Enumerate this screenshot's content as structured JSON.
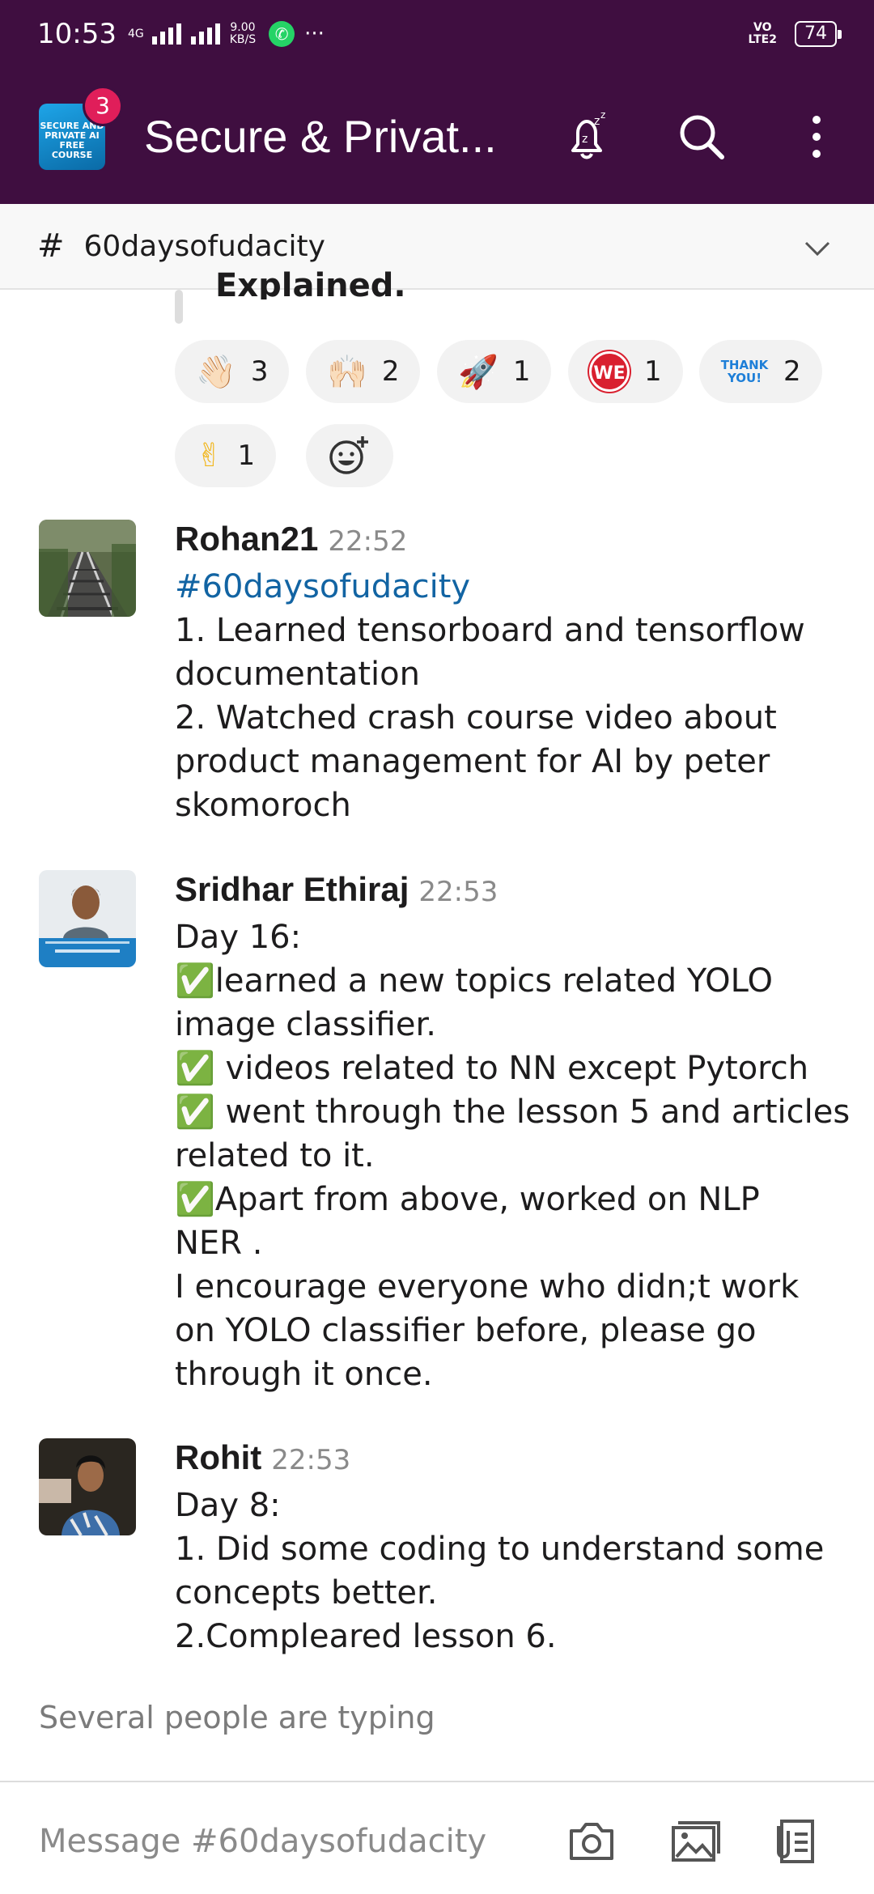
{
  "status_bar": {
    "time": "10:53",
    "net_top": "4G",
    "speed_value": "9.00",
    "speed_unit": "KB/S",
    "more": "···",
    "volte_top": "VO",
    "volte_bottom": "LTE2",
    "battery": "74"
  },
  "app_bar": {
    "workspace_icon_text": "SECURE AND PRIVATE AI FREE COURSE",
    "badge_count": "3",
    "title": "Secure & Privat..."
  },
  "channel_bar": {
    "hash": "#",
    "channel_name": "60daysofudacity"
  },
  "prev_message": {
    "quote_fragment": "Explained."
  },
  "reactions": [
    {
      "emoji": "👋🏻",
      "count": "3"
    },
    {
      "emoji": "🙌🏻",
      "count": "2"
    },
    {
      "emoji": "🚀",
      "count": "1"
    },
    {
      "emoji": "WE",
      "count": "1"
    },
    {
      "emoji": "THANK YOU!",
      "count": "2"
    },
    {
      "emoji": "✌",
      "count": "1"
    }
  ],
  "messages": [
    {
      "author": "Rohan21",
      "time": "22:52",
      "lines": [
        "#60daysofudacity",
        "1. Learned tensorboard and tensorflow",
        "documentation",
        "2. Watched crash course video about",
        "product management for AI by peter",
        "skomoroch"
      ]
    },
    {
      "author": "Sridhar Ethiraj",
      "time": "22:53",
      "lines": [
        "Day 16:",
        "✅learned a new topics related YOLO",
        "image classifier.",
        "✅ videos related to NN except Pytorch",
        "✅ went through the lesson 5 and articles",
        "related to it.",
        "✅Apart from above, worked on NLP",
        "NER .",
        "I encourage everyone who didn;t work",
        "on YOLO classifier before, please go",
        "through it once."
      ]
    },
    {
      "author": "Rohit",
      "time": "22:53",
      "lines": [
        "Day 8:",
        "1. Did some coding to understand some",
        "concepts better.",
        "2.Compleared lesson 6."
      ]
    }
  ],
  "typing_indicator": "Several people are typing",
  "composer": {
    "placeholder": "Message #60daysofudacity"
  }
}
